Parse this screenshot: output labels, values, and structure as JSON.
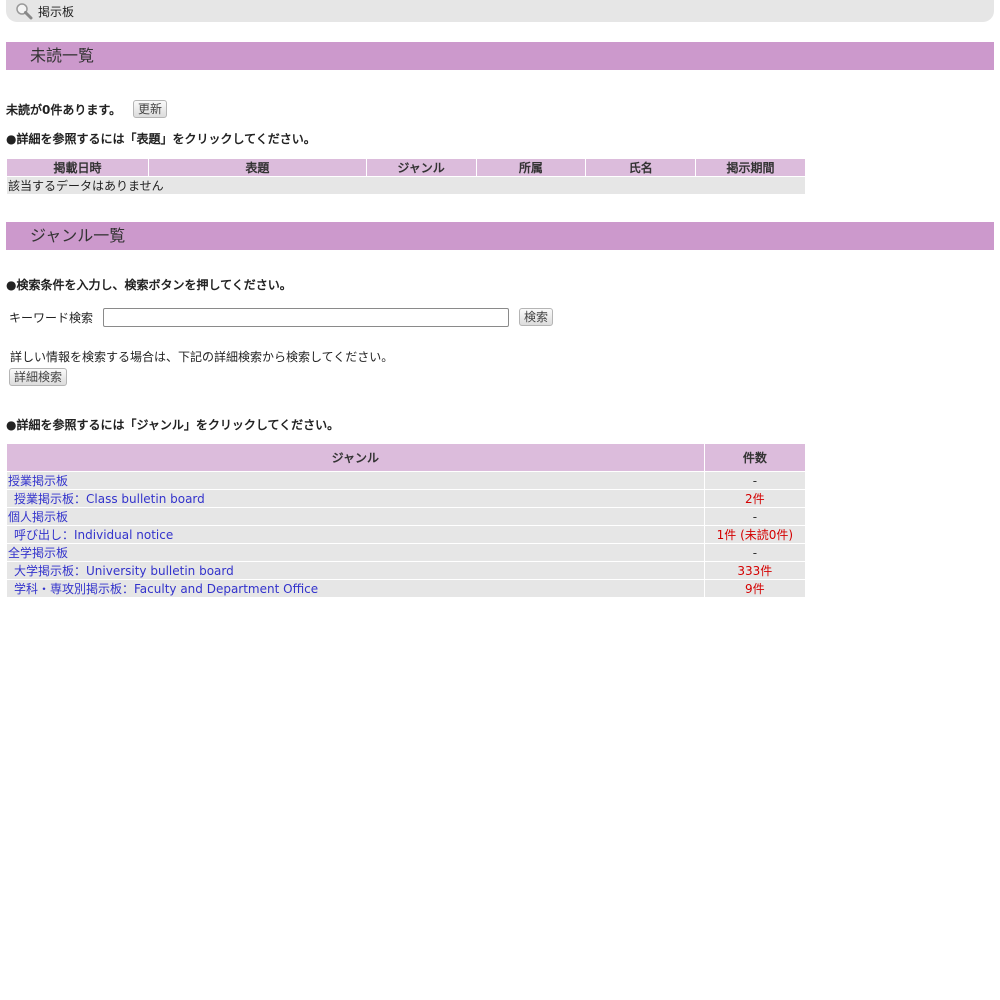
{
  "header": {
    "title": "掲示板"
  },
  "unread": {
    "heading": "未読一覧",
    "count_text": "未読が0件あります。",
    "refresh_label": "更新",
    "instruction": "●詳細を参照するには「表題」をクリックしてください。",
    "columns": [
      "掲載日時",
      "表題",
      "ジャンル",
      "所属",
      "氏名",
      "掲示期間"
    ],
    "empty_text": "該当するデータはありません"
  },
  "genre": {
    "heading": "ジャンル一覧",
    "instruction": "●検索条件を入力し、検索ボタンを押してください。",
    "keyword_label": "キーワード検索",
    "keyword_value": "",
    "search_label": "検索",
    "detail_hint": "詳しい情報を検索する場合は、下記の詳細検索から検索してください。",
    "detail_search_label": "詳細検索",
    "table_instruction": "●詳細を参照するには「ジャンル」をクリックしてください。",
    "columns": [
      "ジャンル",
      "件数"
    ],
    "rows": [
      {
        "name": "授業掲示板",
        "count": "-"
      },
      {
        "name": "授業掲示板：Class bulletin board",
        "count": "2件"
      },
      {
        "name": "個人掲示板",
        "count": "-"
      },
      {
        "name": "呼び出し：Individual notice",
        "count": "1件 (未読0件)"
      },
      {
        "name": "全学掲示板",
        "count": "-"
      },
      {
        "name": "大学掲示板：University bulletin board",
        "count": "333件"
      },
      {
        "name": "学科・専攻別掲示板：Faculty and Department Office",
        "count": "9件"
      }
    ]
  },
  "colors": {
    "section_bg": "#cc99cc",
    "header_cell_bg": "#dcbcdc",
    "link": "#3333cc",
    "count": "#d40000"
  }
}
